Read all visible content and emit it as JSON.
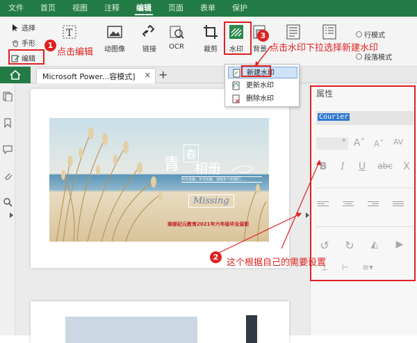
{
  "menubar": {
    "items": [
      "文件",
      "首页",
      "视图",
      "注释",
      "编辑",
      "页面",
      "表单",
      "保护"
    ],
    "active_index": 4,
    "colors": {
      "bg": "#227b45"
    }
  },
  "ribbon": {
    "mode": {
      "select": "选择",
      "hand": "手形",
      "edit": "编辑"
    },
    "tools": {
      "edit_text": "",
      "edit_image": "动图像",
      "link": "链接",
      "ocr": "OCR",
      "crop": "裁剪",
      "watermark": "水印",
      "background": "背景",
      "line_mode": "行模式",
      "para_mode": "段落模式"
    }
  },
  "annotations": {
    "step1_num": "1",
    "step1_text": "点击编辑",
    "step2_num": "2",
    "step2_text": "这个根据自己的需要设置",
    "step3_num": "3",
    "step3_text": "点击水印下拉选择新建水印",
    "color": "#e02020"
  },
  "tabs": {
    "doc_title": "Microsoft Power...容模式]",
    "close": "✕",
    "add": "+"
  },
  "watermark_menu": {
    "items": [
      "新建水印",
      "更新水印",
      "删除水印"
    ],
    "selected_index": 0
  },
  "document": {
    "photo_title_main": "青",
    "photo_title_spring": "春",
    "photo_title_album": "相册",
    "photo_small_text": "时光荏苒，岁月如歌，曾经年少的我们……",
    "photo_missing": "Missing",
    "photo_caption": "南部纪元教育2021年六年级毕业留影"
  },
  "properties": {
    "title": "属性",
    "font_value": "Courier",
    "bold": "B",
    "italic": "I",
    "underline": "U",
    "strike": "abc",
    "clear": "X"
  }
}
